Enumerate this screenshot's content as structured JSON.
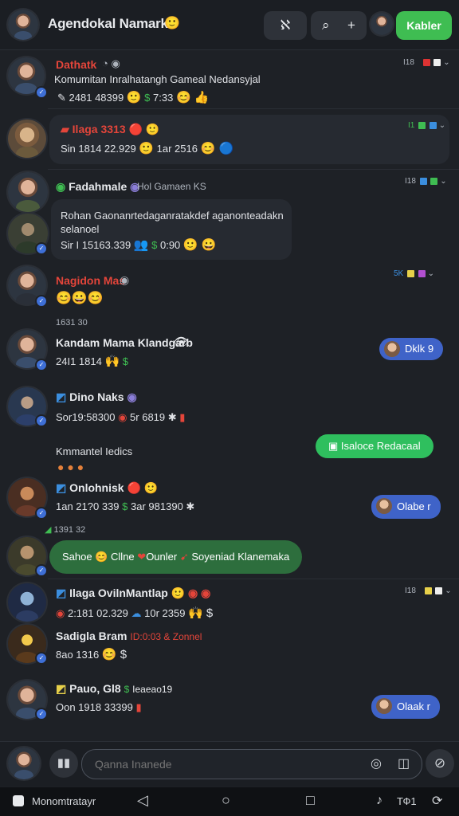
{
  "header": {
    "title": "Agendokal Namark",
    "button_tag": "ℵ",
    "button_search_plus": "+",
    "cta_label": "Kabler"
  },
  "messages": [
    {
      "name": "Dathatk",
      "text": "Komumitan Inralhatangh Gameal Nedansyjal",
      "meta_line": "2481 48399",
      "time": "7:33",
      "side_time": "I18"
    },
    {
      "name": "Ilaga 3313",
      "meta_line": "Sin 1814 22.929",
      "time": "1ar 2516",
      "side_time": "I1"
    },
    {
      "name": "Fadahmale",
      "secondary": "Hol Gamaen KS",
      "text": "Rohan Gaonanrtedaganratakdef aganonteadakn selanoel",
      "meta_line": "Sir I 15163.339",
      "time": "0:90",
      "side_time": "I18"
    },
    {
      "name": "Nagidon Mas",
      "side_time": "5K"
    },
    {
      "timestamp": "1631 30"
    },
    {
      "name": "Kandam Mama Klandgarb",
      "meta_line": "24I1 1814",
      "bubble": "Dklk 9"
    },
    {
      "name": "Dino Naks",
      "meta_line": "Sor19:58300",
      "time": "5r 6819"
    },
    {
      "name": "Kmmantel Iedics",
      "bubble": "Isaloce Redacaal"
    },
    {
      "name": "Onlohnisk",
      "meta_line": "1an 21?0 339",
      "time": "3ar 981390",
      "bubble": "Olabe r"
    },
    {
      "timestamp": "1391 32"
    },
    {
      "pill_text_a": "Sahoe",
      "pill_text_b": "Cllne",
      "pill_text_c": "Ounler",
      "pill_text_d": "Soyeniad Klanemaka"
    },
    {
      "name": "Ilaga OvilnMantlap",
      "meta_line": "2:181 02.329",
      "time": "10r 2359",
      "side_time": "I18"
    },
    {
      "name": "Sadigla Bram",
      "name_extra": "ID:0:03 & Zonnel",
      "meta_line": "8ao 1316"
    },
    {
      "name": "Pauo, Gl8",
      "name_extra": "Ieaeao19",
      "meta_line": "Oon 1918 33399",
      "bubble": "Olaak r"
    }
  ],
  "composer": {
    "placeholder": "Qanna Inanede"
  },
  "system_bar": {
    "app_label": "Monomtratayr",
    "right_label": "ТФ1"
  }
}
